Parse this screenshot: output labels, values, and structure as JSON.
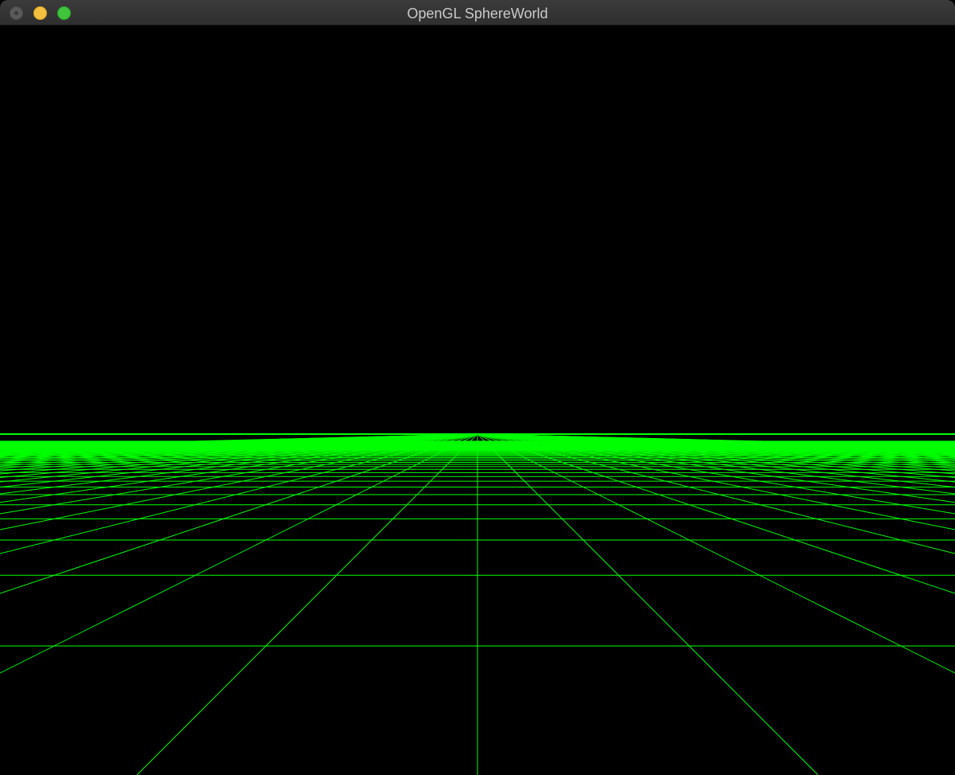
{
  "window": {
    "title": "OpenGL SphereWorld"
  },
  "scene": {
    "background_color": "#000000",
    "grid_color": "#00ff00"
  }
}
